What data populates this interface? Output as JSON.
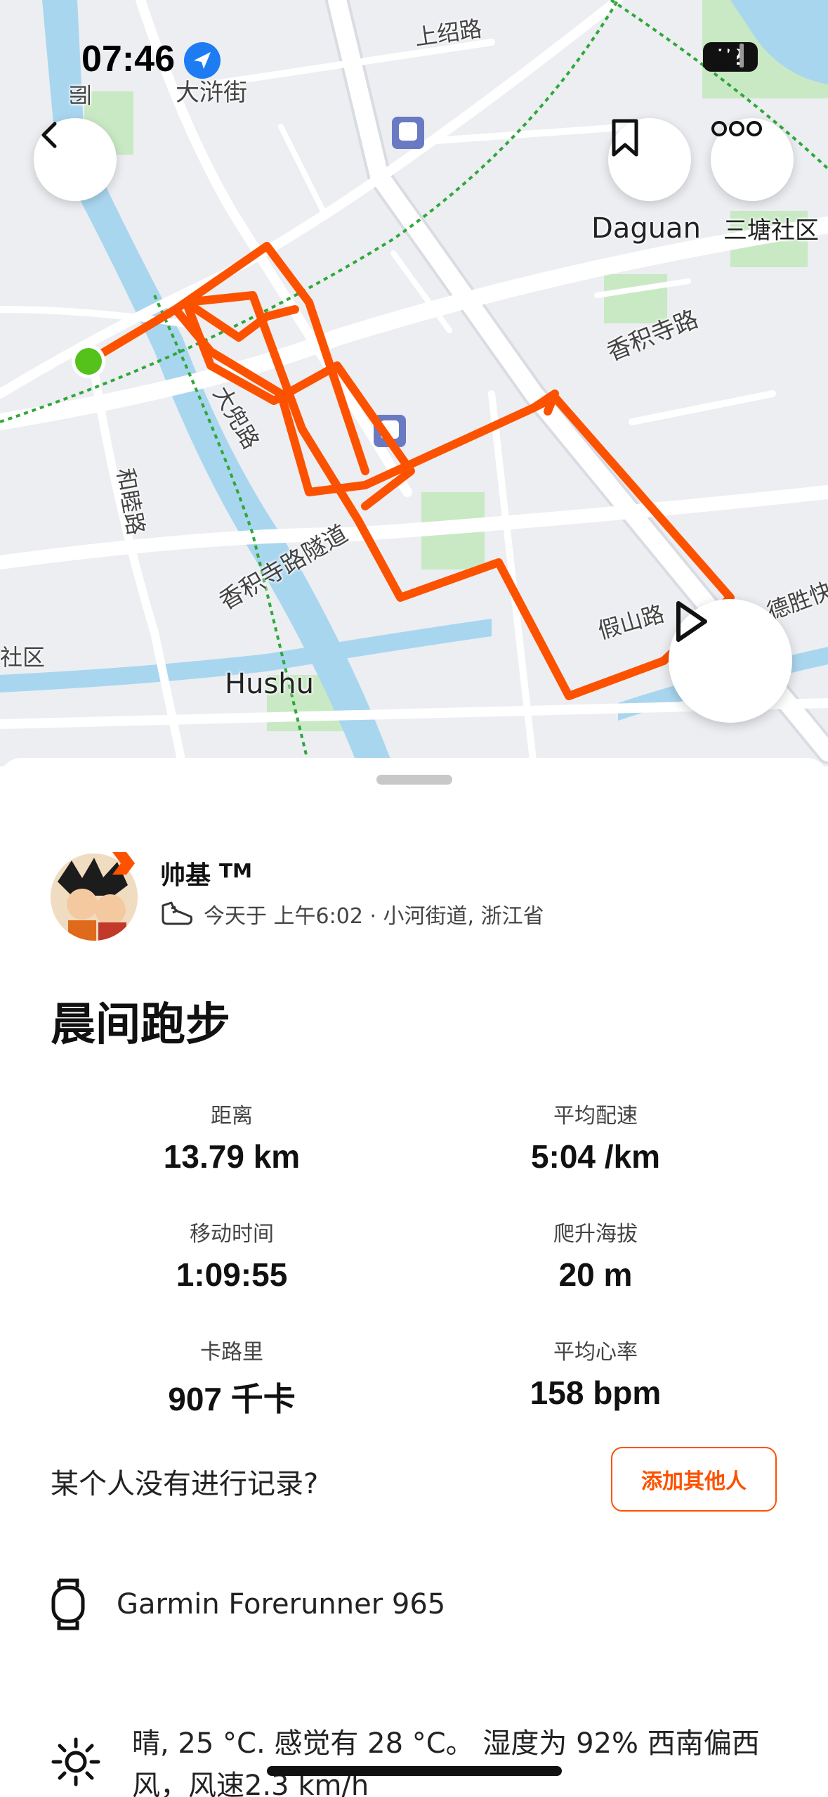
{
  "status_bar": {
    "time": "07:46",
    "battery": "72"
  },
  "map": {
    "labels": {
      "dajie": "大浒街",
      "shangshao": "上绍路",
      "li": "丽",
      "daguan": "Daguan",
      "santang": "三塘社区",
      "xiangjisi_road": "香积寺路",
      "dadou_road": "大兜路",
      "hemu_road": "和睦路",
      "tunnel": "香积寺路隧道",
      "jiashan_road": "假山路",
      "desheng": "德胜快",
      "hushu": "Hushu",
      "shequ_left": "社区"
    },
    "colors": {
      "route": "#fc5200",
      "start": "#55c21b",
      "water": "#a9d6ef",
      "park": "#c9e9c4",
      "road": "#ffffff"
    }
  },
  "actions": {
    "back_icon": "chevron-left-icon",
    "bookmark_icon": "bookmark-icon",
    "more_icon": "more-dots-icon",
    "play_icon": "play-icon"
  },
  "athlete": {
    "name": "帅基",
    "tm": "TM",
    "meta": "今天于 上午6:02 · 小河街道, 浙江省"
  },
  "activity": {
    "title": "晨间跑步",
    "stats": [
      {
        "label": "距离",
        "value": "13.79 km"
      },
      {
        "label": "平均配速",
        "value": "5:04 /km"
      },
      {
        "label": "移动时间",
        "value": "1:09:55"
      },
      {
        "label": "爬升海拔",
        "value": "20 m"
      },
      {
        "label": "卡路里",
        "value": "907 千卡"
      },
      {
        "label": "平均心率",
        "value": "158 bpm"
      }
    ]
  },
  "group": {
    "prompt": "某个人没有进行记录?",
    "add_button": "添加其他人"
  },
  "device": {
    "name": "Garmin Forerunner 965",
    "icon": "watch-icon"
  },
  "weather": {
    "text": "晴, 25 °C. 感觉有 28 °C。 湿度为 92% 西南偏西 风，风速2.3 km/h",
    "icon": "sun-icon"
  }
}
